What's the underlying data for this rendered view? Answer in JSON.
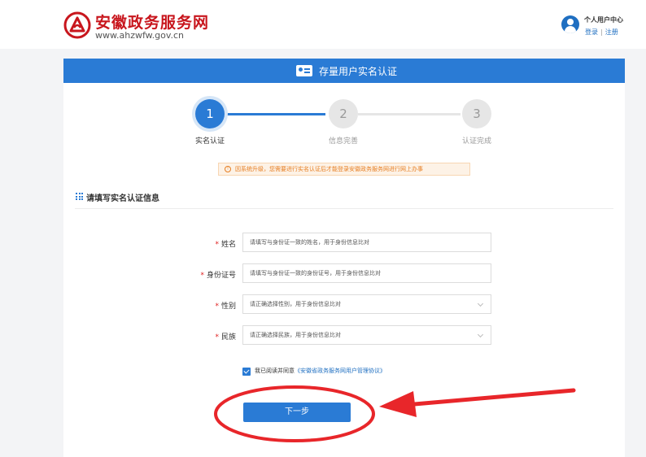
{
  "header": {
    "site_title": "安徽政务服务网",
    "site_url": "www.ahzwfw.gov.cn",
    "user_title": "个人用户中心",
    "login_label": "登录",
    "register_label": "注册"
  },
  "banner": {
    "title": "存量用户实名认证"
  },
  "steps": [
    {
      "number": "1",
      "label": "实名认证",
      "active": true
    },
    {
      "number": "2",
      "label": "信息完善",
      "active": false
    },
    {
      "number": "3",
      "label": "认证完成",
      "active": false
    }
  ],
  "notice": {
    "icon": "!",
    "text": "因系统升级，您需要进行实名认证后才能登录安徽政务服务网进行网上办事"
  },
  "section": {
    "title": "请填写实名认证信息"
  },
  "form": {
    "required_mark": "*",
    "name_label": "姓名",
    "name_placeholder": "请填写与身份证一致的姓名，用于身份信息比对",
    "id_label": "身份证号",
    "id_placeholder": "请填写与身份证一致的身份证号，用于身份信息比对",
    "gender_label": "性别",
    "gender_placeholder": "请正确选择性别，用于身份信息比对",
    "ethnicity_label": "民族",
    "ethnicity_placeholder": "请正确选择民族，用于身份信息比对"
  },
  "agreement": {
    "checked": true,
    "prefix": "我已阅读并同意",
    "link": "《安徽省政务服务网用户管理协议》"
  },
  "next_button": {
    "label": "下一步"
  },
  "colors": {
    "primary": "#2a7bd5",
    "brand_red": "#c8161d",
    "annotation_red": "#e8262a"
  }
}
